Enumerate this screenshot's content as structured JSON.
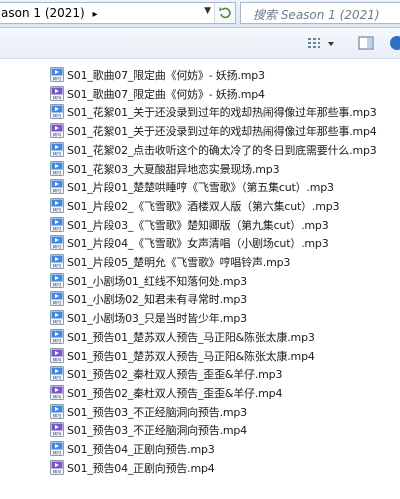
{
  "address": {
    "crumb": "ason 1 (2021)",
    "arrow": "▸"
  },
  "search": {
    "placeholder": "搜索 Season 1 (2021)"
  },
  "files": [
    {
      "name": "S01_歌曲07_限定曲《何妨》- 妖扬.mp3",
      "type": "mp3"
    },
    {
      "name": "S01_歌曲07_限定曲《何妨》- 妖扬.mp4",
      "type": "mp4"
    },
    {
      "name": "S01_花絮01_关于还没录到过年的戏却热闹得像过年那些事.mp3",
      "type": "mp3"
    },
    {
      "name": "S01_花絮01_关于还没录到过年的戏却热闹得像过年那些事.mp4",
      "type": "mp4"
    },
    {
      "name": "S01_花絮02_点击收听这个的确太冷了的冬日到底需要什么.mp3",
      "type": "mp3"
    },
    {
      "name": "S01_花絮03_大夏酸甜异地恋实景现场.mp3",
      "type": "mp3"
    },
    {
      "name": "S01_片段01_楚楚哄睡哼《飞雪歌》（第五集cut）.mp3",
      "type": "mp3"
    },
    {
      "name": "S01_片段02_《飞雪歌》酒楼双人版（第六集cut）.mp3",
      "type": "mp3"
    },
    {
      "name": "S01_片段03_《飞雪歌》楚知卿版（第九集cut）.mp3",
      "type": "mp3"
    },
    {
      "name": "S01_片段04_《飞雪歌》女声清唱（小剧场cut）.mp3",
      "type": "mp3"
    },
    {
      "name": "S01_片段05_楚明允《飞雪歌》哼唱铃声.mp3",
      "type": "mp3"
    },
    {
      "name": "S01_小剧场01_红线不知落何处.mp3",
      "type": "mp3"
    },
    {
      "name": "S01_小剧场02_知君未有寻常时.mp3",
      "type": "mp3"
    },
    {
      "name": "S01_小剧场03_只是当时皆少年.mp3",
      "type": "mp3"
    },
    {
      "name": "S01_预告01_楚苏双人预告_马正阳&陈张太康.mp3",
      "type": "mp3"
    },
    {
      "name": "S01_预告01_楚苏双人预告_马正阳&陈张太康.mp4",
      "type": "mp4"
    },
    {
      "name": "S01_预告02_秦杜双人预告_歪歪&羊仔.mp3",
      "type": "mp3"
    },
    {
      "name": "S01_预告02_秦杜双人预告_歪歪&羊仔.mp4",
      "type": "mp4"
    },
    {
      "name": "S01_预告03_不正经脑洞向预告.mp3",
      "type": "mp3"
    },
    {
      "name": "S01_预告03_不正经脑洞向预告.mp4",
      "type": "mp4"
    },
    {
      "name": "S01_预告04_正剧向预告.mp3",
      "type": "mp3"
    },
    {
      "name": "S01_预告04_正剧向预告.mp4",
      "type": "mp4"
    }
  ],
  "icon_labels": {
    "mp3": "MP3",
    "mp4": "MP4"
  },
  "colors": {
    "mp3": "#3f8ae0",
    "mp4": "#7a56c8"
  }
}
